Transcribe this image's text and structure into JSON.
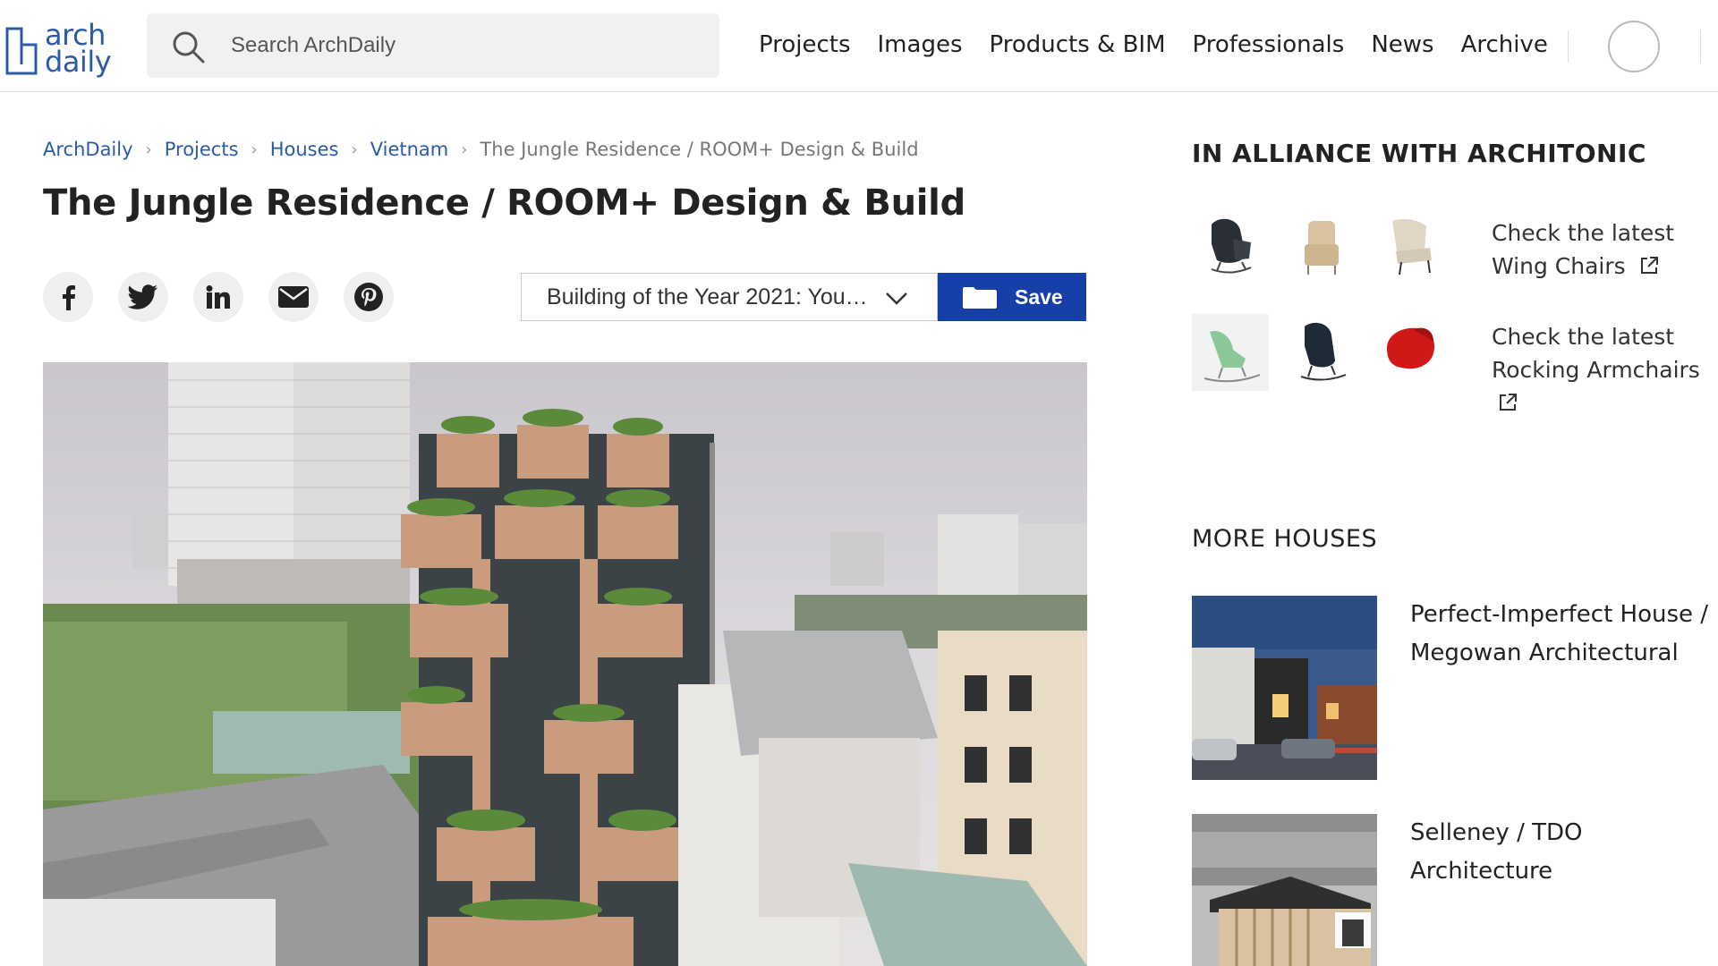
{
  "header": {
    "logo_line1": "arch",
    "logo_line2": "daily",
    "search_placeholder": "Search ArchDaily",
    "nav": [
      "Projects",
      "Images",
      "Products & BIM",
      "Professionals",
      "News",
      "Archive"
    ]
  },
  "breadcrumb": [
    "ArchDaily",
    "Projects",
    "Houses",
    "Vietnam",
    "The Jungle Residence / ROOM+ Design & Build"
  ],
  "title": "The Jungle Residence / ROOM+ Design & Build",
  "social_icons": [
    "facebook-icon",
    "twitter-icon",
    "linkedin-icon",
    "email-icon",
    "pinterest-icon"
  ],
  "collection_select": "Building of the Year 2021: You…",
  "save_label": "Save",
  "sidebar": {
    "alliance_title": "IN ALLIANCE WITH ARCHITONIC",
    "links": [
      "Check the latest Wing Chairs",
      "Check the latest Rocking Armchairs"
    ],
    "more_title": "MORE HOUSES",
    "cards": [
      "Perfect-Imperfect House / Megowan Architectural",
      "Selleney / TDO Architecture"
    ]
  },
  "colors": {
    "brand_blue": "#2a5aa8",
    "save_button": "#1640a8"
  }
}
